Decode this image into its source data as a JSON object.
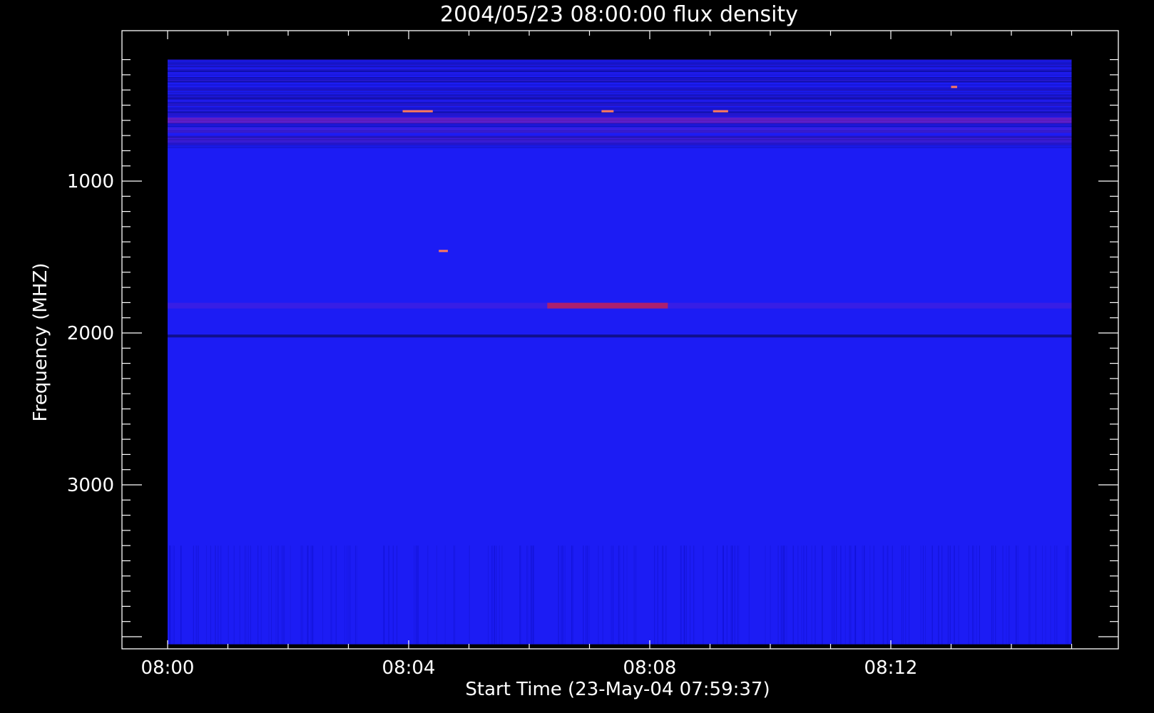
{
  "chart_data": {
    "type": "heatmap",
    "title": "2004/05/23 08:00:00 flux density",
    "xlabel": "Start Time (23-May-04 07:59:37)",
    "ylabel": "Frequency (MHZ)",
    "x_ticks": [
      "08:00",
      "08:04",
      "08:08",
      "08:12"
    ],
    "x_tick_minutes": [
      0,
      4,
      8,
      12
    ],
    "x_data_range_minutes": [
      0,
      15
    ],
    "y_ticks": [
      1000,
      2000,
      3000
    ],
    "y_range": [
      100,
      4000
    ],
    "y_data_range": [
      200,
      4050
    ],
    "colormap": [
      "#000000",
      "#0a10b8",
      "#1a1ef5",
      "#7a20c8",
      "#e0203a",
      "#ff8060"
    ],
    "background_color": "#1c1cf4",
    "features": [
      {
        "kind": "band",
        "freq_mhz": 1820,
        "t_start_min": 0,
        "t_end_min": 15,
        "intensity": 0.35
      },
      {
        "kind": "band",
        "freq_mhz": 1820,
        "t_start_min": 6.3,
        "t_end_min": 8.3,
        "intensity": 0.85
      },
      {
        "kind": "band",
        "freq_mhz": 600,
        "t_start_min": 0,
        "t_end_min": 15,
        "intensity": 0.5
      },
      {
        "kind": "band",
        "freq_mhz": 665,
        "t_start_min": 0,
        "t_end_min": 15,
        "intensity": 0.4
      },
      {
        "kind": "band",
        "freq_mhz": 730,
        "t_start_min": 0,
        "t_end_min": 15,
        "intensity": 0.3
      },
      {
        "kind": "dark_line",
        "freq_mhz": 2020,
        "t_start_min": 0,
        "t_end_min": 15
      },
      {
        "kind": "spot",
        "freq_mhz": 540,
        "t_start_min": 3.9,
        "t_end_min": 4.4
      },
      {
        "kind": "spot",
        "freq_mhz": 540,
        "t_start_min": 7.2,
        "t_end_min": 7.4
      },
      {
        "kind": "spot",
        "freq_mhz": 540,
        "t_start_min": 9.05,
        "t_end_min": 9.3
      },
      {
        "kind": "spot",
        "freq_mhz": 380,
        "t_start_min": 13.0,
        "t_end_min": 13.1
      },
      {
        "kind": "spot",
        "freq_mhz": 1460,
        "t_start_min": 4.5,
        "t_end_min": 4.65
      }
    ]
  }
}
